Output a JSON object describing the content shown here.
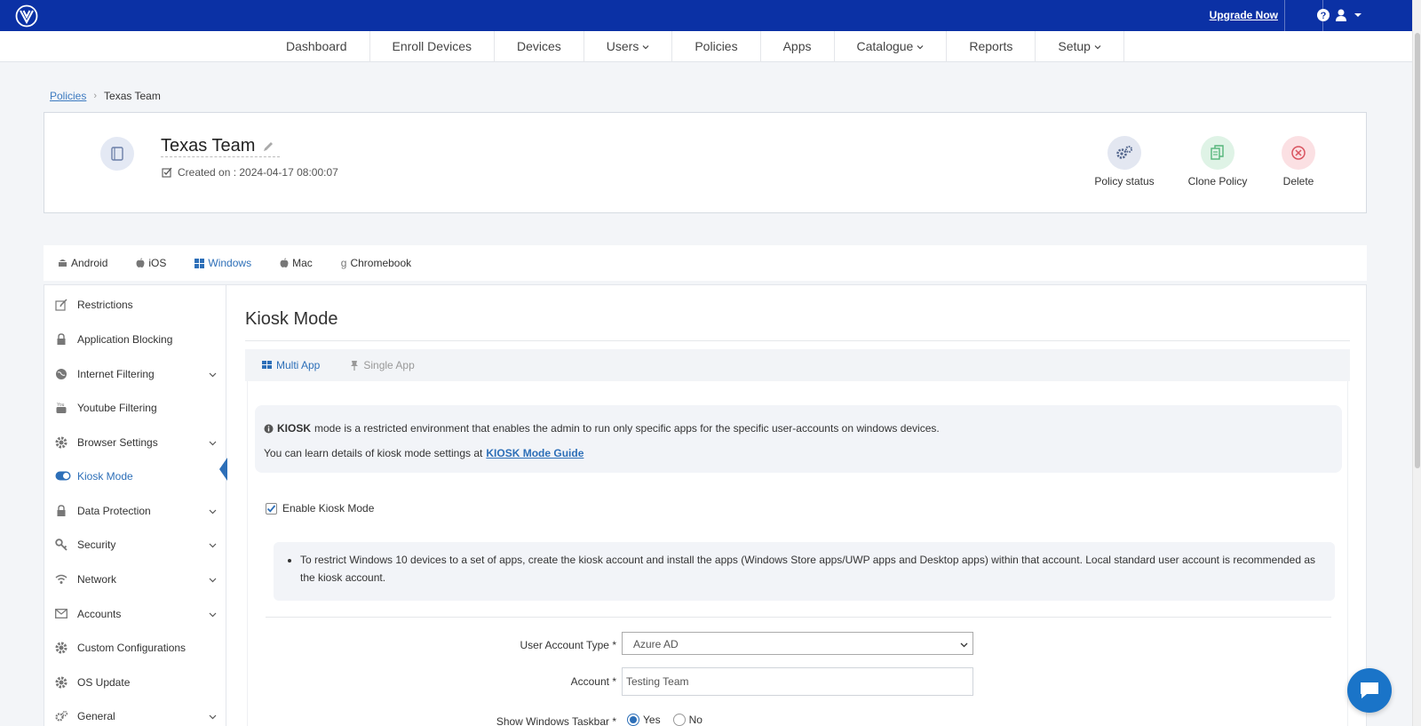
{
  "topbar": {
    "upgrade_label": "Upgrade Now",
    "logo_icon": "brand-logo-icon",
    "help_icon": "question-circle-icon",
    "user_icon": "user-icon"
  },
  "nav": {
    "items": [
      {
        "label": "Dashboard",
        "dropdown": false
      },
      {
        "label": "Enroll Devices",
        "dropdown": false
      },
      {
        "label": "Devices",
        "dropdown": false
      },
      {
        "label": "Users",
        "dropdown": true
      },
      {
        "label": "Policies",
        "dropdown": false
      },
      {
        "label": "Apps",
        "dropdown": false
      },
      {
        "label": "Catalogue",
        "dropdown": true
      },
      {
        "label": "Reports",
        "dropdown": false
      },
      {
        "label": "Setup",
        "dropdown": true
      }
    ]
  },
  "breadcrumb": {
    "parent": "Policies",
    "current": "Texas Team"
  },
  "policy": {
    "name": "Texas Team",
    "created": "Created on : 2024-04-17 08:00:07",
    "actions": {
      "status": "Policy status",
      "clone": "Clone Policy",
      "delete": "Delete"
    }
  },
  "os_tabs": {
    "android": "Android",
    "ios": "iOS",
    "windows": "Windows",
    "mac": "Mac",
    "chromebook": "Chromebook",
    "active": "Windows"
  },
  "sidebar": {
    "items": [
      {
        "label": "Restrictions",
        "icon": "edit-icon",
        "expandable": false
      },
      {
        "label": "Application Blocking",
        "icon": "lock-icon",
        "expandable": false
      },
      {
        "label": "Internet Filtering",
        "icon": "globe-icon",
        "expandable": true
      },
      {
        "label": "Youtube Filtering",
        "icon": "youtube-icon",
        "expandable": false
      },
      {
        "label": "Browser Settings",
        "icon": "gear-icon",
        "expandable": true
      },
      {
        "label": "Kiosk Mode",
        "icon": "toggle-icon",
        "expandable": false
      },
      {
        "label": "Data Protection",
        "icon": "lock-icon",
        "expandable": true
      },
      {
        "label": "Security",
        "icon": "key-icon",
        "expandable": true
      },
      {
        "label": "Network",
        "icon": "wifi-icon",
        "expandable": true
      },
      {
        "label": "Accounts",
        "icon": "envelope-icon",
        "expandable": true
      },
      {
        "label": "Custom Configurations",
        "icon": "gear-icon",
        "expandable": false
      },
      {
        "label": "OS Update",
        "icon": "gear-icon",
        "expandable": false
      },
      {
        "label": "General",
        "icon": "gears-icon",
        "expandable": true
      }
    ],
    "active": "Kiosk Mode"
  },
  "kiosk": {
    "title": "Kiosk Mode",
    "subtabs": {
      "multi": "Multi App",
      "single": "Single App",
      "active": "Multi App"
    },
    "info": {
      "keyword": "KIOSK",
      "text": "mode is a restricted environment that enables the admin to run only specific apps for the specific user-accounts on windows devices.",
      "learn_text": "You can learn details of kiosk mode settings at",
      "guide_link": "KIOSK Mode Guide"
    },
    "enable_label": "Enable Kiosk Mode",
    "enable_checked": true,
    "note": "To restrict Windows 10 devices to a set of apps, create the kiosk account and install the apps (Windows Store apps/UWP apps and Desktop apps) within that account. Local standard user account is recommended as the kiosk account.",
    "form": {
      "account_type_label": "User Account Type *",
      "account_type_value": "Azure AD",
      "account_label": "Account *",
      "account_value": "Testing Team",
      "taskbar_label": "Show Windows Taskbar *",
      "taskbar_yes": "Yes",
      "taskbar_no": "No",
      "taskbar_selected": "Yes"
    }
  },
  "colors": {
    "topbar": "#0b31a5",
    "accent": "#2d6fb8",
    "chat": "#1a74c8"
  }
}
